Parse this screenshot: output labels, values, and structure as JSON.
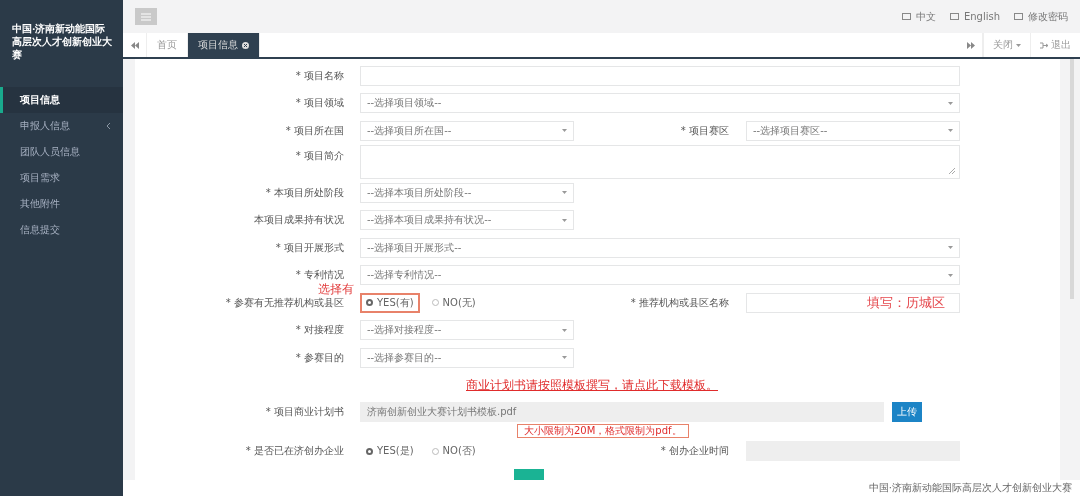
{
  "sidebar": {
    "title": "中国·济南新动能国际高层次人才创新创业大赛",
    "items": [
      {
        "label": "项目信息",
        "selected": true,
        "has_children": false
      },
      {
        "label": "申报人信息",
        "selected": false,
        "has_children": true
      },
      {
        "label": "团队人员信息",
        "selected": false,
        "has_children": false
      },
      {
        "label": "项目需求",
        "selected": false,
        "has_children": false
      },
      {
        "label": "其他附件",
        "selected": false,
        "has_children": false
      },
      {
        "label": "信息提交",
        "selected": false,
        "has_children": false
      }
    ]
  },
  "header": {
    "links": [
      {
        "label": "中文"
      },
      {
        "label": "English"
      },
      {
        "label": "修改密码"
      }
    ]
  },
  "tabs": [
    {
      "label": "首页",
      "selected": false,
      "closable": false
    },
    {
      "label": "项目信息",
      "selected": true,
      "closable": true
    }
  ],
  "tab_actions": [
    {
      "label": "关闭",
      "kind": "dropdown"
    },
    {
      "label": "退出",
      "kind": "exit"
    }
  ],
  "form": [
    {
      "kind": "input",
      "label": "* 项目名称"
    },
    {
      "kind": "select",
      "label": "* 项目领域",
      "placeholder": "--选择项目领域--"
    },
    {
      "kind": "select-short",
      "label": "* 项目所在国",
      "placeholder": "--选择项目所在国--",
      "second": {
        "kind": "select",
        "label": "* 项目赛区",
        "placeholder": "--选择项目赛区--"
      }
    },
    {
      "kind": "textarea",
      "label": "* 项目简介"
    },
    {
      "kind": "select-short",
      "label": "* 本项目所处阶段",
      "placeholder": "--选择本项目所处阶段--"
    },
    {
      "kind": "select-short",
      "label": "本项目成果持有状况",
      "placeholder": "--选择本项目成果持有状况--"
    },
    {
      "kind": "select",
      "label": "* 项目开展形式",
      "placeholder": "--选择项目开展形式--"
    },
    {
      "kind": "select",
      "label": "* 专利情况",
      "placeholder": "--选择专利情况--"
    },
    {
      "kind": "radio",
      "label": "* 参赛有无推荐机构或县区",
      "annotation": "选择有",
      "options": [
        {
          "label": "YES(有)",
          "selected": true
        },
        {
          "label": "NO(无)",
          "selected": false
        }
      ],
      "second": {
        "kind": "input",
        "label": "* 推荐机构或县区名称",
        "annotation": "填写：历城区"
      }
    },
    {
      "kind": "select-short",
      "label": "* 对接程度",
      "placeholder": "--选择对接程度--"
    },
    {
      "kind": "select-short",
      "label": "* 参赛目的",
      "placeholder": "--选择参赛目的--"
    },
    {
      "kind": "link",
      "text": "商业计划书请按照模板撰写，请点此下载模板。"
    },
    {
      "kind": "file",
      "label": "* 项目商业计划书",
      "value": "济南创新创业大赛计划书模板.pdf",
      "button": "上传"
    },
    {
      "kind": "note",
      "text": "大小限制为20M，格式限制为pdf。"
    },
    {
      "kind": "radio",
      "label": "* 是否已在济创办企业",
      "options": [
        {
          "label": "YES(是)",
          "selected": true
        },
        {
          "label": "NO(否)",
          "selected": false
        }
      ],
      "second": {
        "kind": "disabled-input",
        "label": "* 创办企业时间"
      }
    },
    {
      "kind": "button"
    }
  ],
  "footer": "中国·济南新动能国际高层次人才创新创业大赛"
}
